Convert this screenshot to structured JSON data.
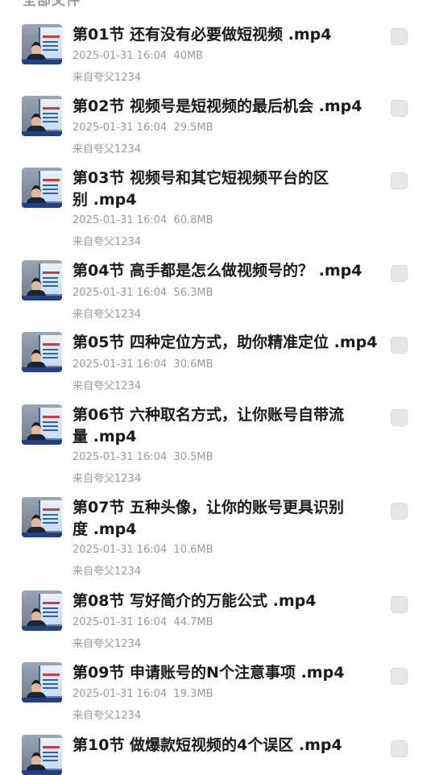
{
  "section_header": "全部文件",
  "files": [
    {
      "title": "第01节 还有没有必要做短视频 .mp4",
      "date": "2025-01-31 16:04",
      "size": "40MB",
      "source": "来自夸父1234"
    },
    {
      "title": "第02节 视频号是短视频的最后机会 .mp4",
      "date": "2025-01-31 16:04",
      "size": "29.5MB",
      "source": "来自夸父1234"
    },
    {
      "title": "第03节 视频号和其它短视频平台的区别 .mp4",
      "date": "2025-01-31 16:04",
      "size": "60.8MB",
      "source": "来自夸父1234"
    },
    {
      "title": "第04节 高手都是怎么做视频号的？ .mp4",
      "date": "2025-01-31 16:04",
      "size": "56.3MB",
      "source": "来自夸父1234"
    },
    {
      "title": "第05节 四种定位方式，助你精准定位 .mp4",
      "date": "2025-01-31 16:04",
      "size": "30.6MB",
      "source": "来自夸父1234"
    },
    {
      "title": "第06节 六种取名方式，让你账号自带流量 .mp4",
      "date": "2025-01-31 16:04",
      "size": "30.5MB",
      "source": "来自夸父1234"
    },
    {
      "title": "第07节 五种头像，让你的账号更具识别度 .mp4",
      "date": "2025-01-31 16:04",
      "size": "10.6MB",
      "source": "来自夸父1234"
    },
    {
      "title": "第08节 写好简介的万能公式 .mp4",
      "date": "2025-01-31 16:04",
      "size": "44.7MB",
      "source": "来自夸父1234"
    },
    {
      "title": "第09节 申请账号的N个注意事项 .mp4",
      "date": "2025-01-31 16:04",
      "size": "19.3MB",
      "source": "来自夸父1234"
    },
    {
      "title": "第10节 做爆款短视频的4个误区 .mp4",
      "date": "",
      "size": "",
      "source": ""
    }
  ]
}
